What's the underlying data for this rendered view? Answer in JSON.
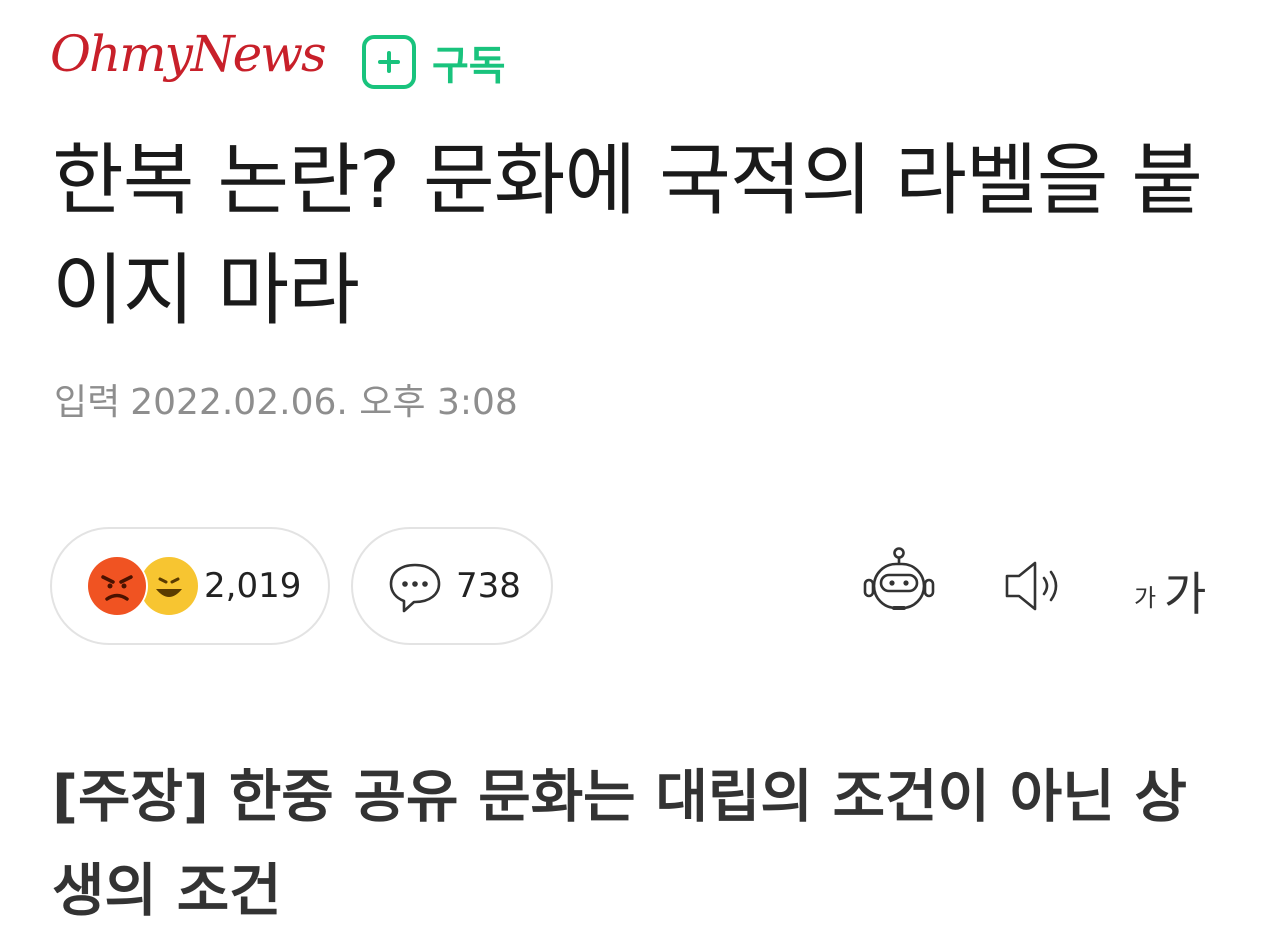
{
  "header": {
    "logo_text": "OhmyNews",
    "subscribe_label": "구독",
    "brand_color": "#c8202a",
    "accent_color": "#19c37d"
  },
  "article": {
    "title": "한복 논란? 문화에 국적의 라벨을 붙이지 마라",
    "date_label": "입력",
    "date_value": "2022.02.06. 오후 3:08",
    "subtitle": "[주장] 한중 공유 문화는 대립의 조건이 아닌 상생의 조건"
  },
  "reactions": {
    "count": "2,019",
    "icons": [
      "angry-emoji-icon",
      "laughing-emoji-icon"
    ]
  },
  "comments": {
    "count": "738",
    "icon": "speech-bubble-icon"
  },
  "tools": {
    "summary_bot_icon": "robot-icon",
    "tts_icon": "speaker-icon",
    "font_size_label_small": "가",
    "font_size_label_large": "가"
  }
}
